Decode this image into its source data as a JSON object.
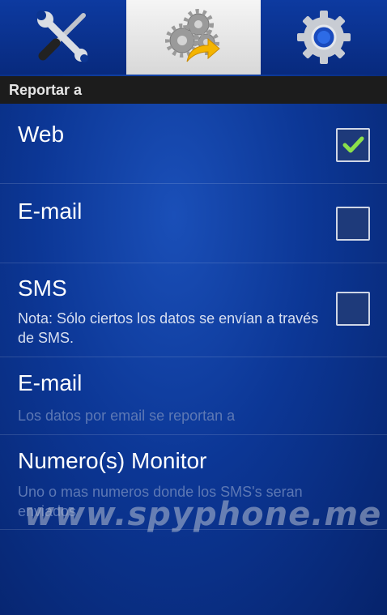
{
  "tabs": [
    {
      "icon": "tools-icon",
      "active": false
    },
    {
      "icon": "gears-arrow-icon",
      "active": true
    },
    {
      "icon": "settings-gear-icon",
      "active": false
    }
  ],
  "section": {
    "header": "Reportar a"
  },
  "items": [
    {
      "title": "Web",
      "checked": true
    },
    {
      "title": "E-mail",
      "checked": false
    },
    {
      "title": "SMS",
      "summary": "Nota: Sólo ciertos los datos se envían a través de SMS.",
      "checked": false
    },
    {
      "title": "E-mail",
      "summary": "Los datos por email se reportan a"
    },
    {
      "title": "Numero(s) Monitor",
      "summary": "Uno o mas numeros donde los SMS's seran enviados"
    }
  ],
  "watermark": "www.spyphone.me",
  "colors": {
    "accent_check": "#8be04b",
    "summary_light": "#d8dff0",
    "summary_dim": "#5d78b4"
  }
}
